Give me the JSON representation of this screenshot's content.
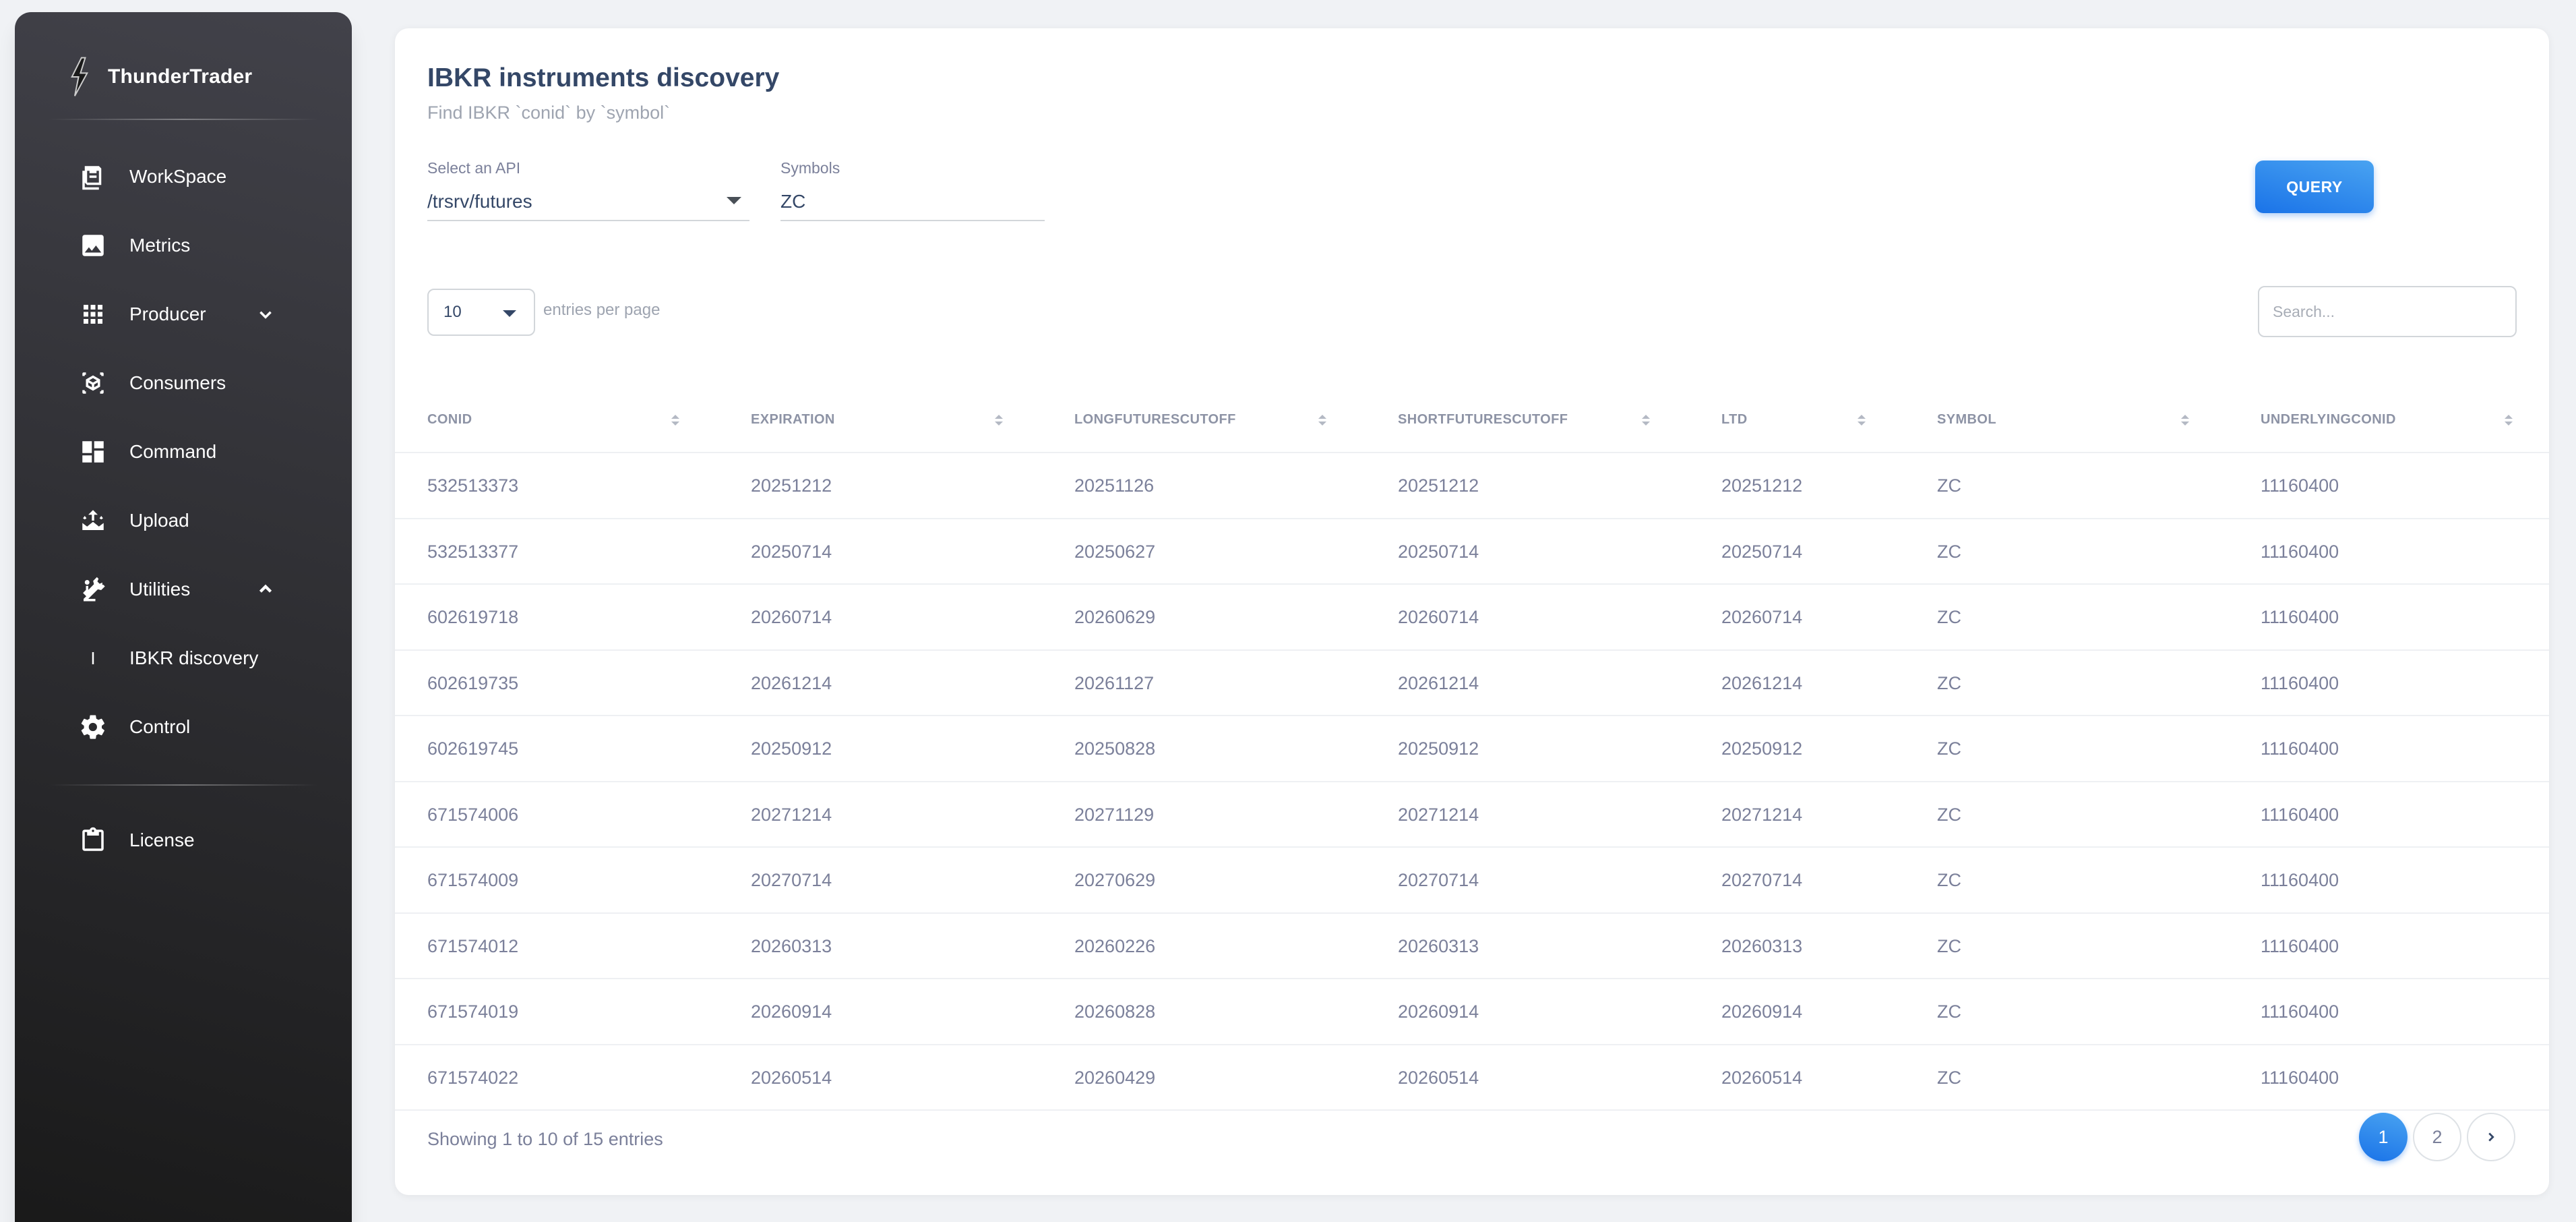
{
  "sidebar": {
    "brand": "ThunderTrader",
    "items": [
      {
        "label": "WorkSpace",
        "icon": "workspace-icon"
      },
      {
        "label": "Metrics",
        "icon": "image-icon"
      },
      {
        "label": "Producer",
        "icon": "apps-grid-icon",
        "expandable": true,
        "expanded": false
      },
      {
        "label": "Consumers",
        "icon": "view-in-ar-icon"
      },
      {
        "label": "Command",
        "icon": "dashboard-icon"
      },
      {
        "label": "Upload",
        "icon": "upload-icon"
      },
      {
        "label": "Utilities",
        "icon": "precision-manufacturing-icon",
        "expandable": true,
        "expanded": true
      },
      {
        "label": "IBKR discovery",
        "prefix": "I",
        "sub": true
      },
      {
        "label": "Control",
        "icon": "settings-gear-icon"
      },
      {
        "label": "License",
        "icon": "clipboard-icon"
      }
    ]
  },
  "main": {
    "title": "IBKR instruments discovery",
    "subtitle": "Find IBKR `conid` by `symbol`",
    "api_label": "Select an API",
    "api_value": "/trsrv/futures",
    "symbols_label": "Symbols",
    "symbols_value": "ZC",
    "query_button": "QUERY",
    "per_page_value": "10",
    "per_page_label": "entries per page",
    "search_placeholder": "Search...",
    "columns": [
      "CONID",
      "EXPIRATION",
      "LONGFUTURESCUTOFF",
      "SHORTFUTURESCUTOFF",
      "LTD",
      "SYMBOL",
      "UNDERLYINGCONID"
    ],
    "rows": [
      [
        "532513373",
        "20251212",
        "20251126",
        "20251212",
        "20251212",
        "ZC",
        "11160400"
      ],
      [
        "532513377",
        "20250714",
        "20250627",
        "20250714",
        "20250714",
        "ZC",
        "11160400"
      ],
      [
        "602619718",
        "20260714",
        "20260629",
        "20260714",
        "20260714",
        "ZC",
        "11160400"
      ],
      [
        "602619735",
        "20261214",
        "20261127",
        "20261214",
        "20261214",
        "ZC",
        "11160400"
      ],
      [
        "602619745",
        "20250912",
        "20250828",
        "20250912",
        "20250912",
        "ZC",
        "11160400"
      ],
      [
        "671574006",
        "20271214",
        "20271129",
        "20271214",
        "20271214",
        "ZC",
        "11160400"
      ],
      [
        "671574009",
        "20270714",
        "20270629",
        "20270714",
        "20270714",
        "ZC",
        "11160400"
      ],
      [
        "671574012",
        "20260313",
        "20260226",
        "20260313",
        "20260313",
        "ZC",
        "11160400"
      ],
      [
        "671574019",
        "20260914",
        "20260828",
        "20260914",
        "20260914",
        "ZC",
        "11160400"
      ],
      [
        "671574022",
        "20260514",
        "20260429",
        "20260514",
        "20260514",
        "ZC",
        "11160400"
      ]
    ],
    "footer_info": "Showing 1 to 10 of 15 entries",
    "pages": [
      "1",
      "2"
    ],
    "active_page": "1"
  },
  "colors": {
    "accent": "#1a73e8",
    "sidebar_top": "#42424a",
    "sidebar_bottom": "#191919"
  }
}
